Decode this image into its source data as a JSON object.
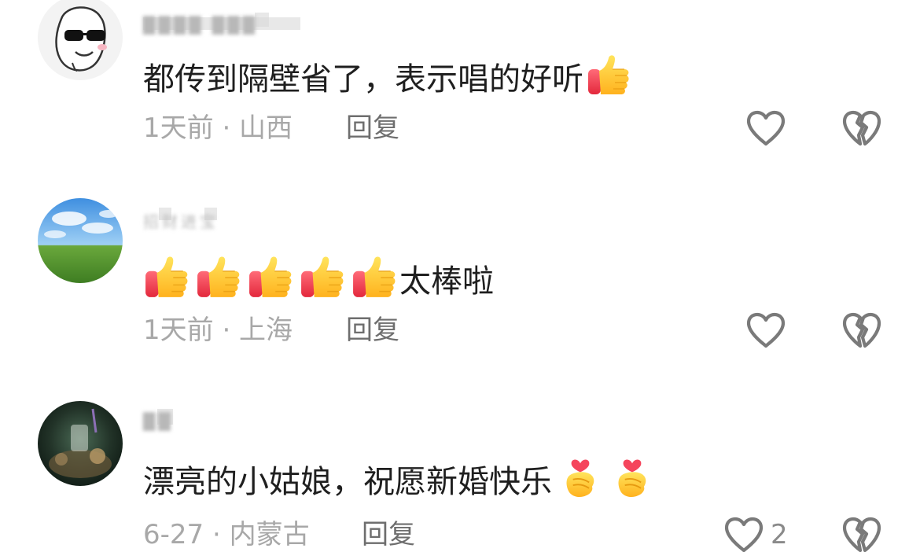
{
  "comments": [
    {
      "username": "████ ███",
      "text": "都传到隔壁省了，表示唱的好听",
      "emojis": [
        "thumbs-up"
      ],
      "meta": "1天前 · 山西",
      "reply_label": "回复",
      "like_count": "",
      "avatar": "meme-face-sunglasses"
    },
    {
      "username": "招财进宝",
      "text": "太棒啦",
      "emojis_before": [
        "thumbs-up",
        "thumbs-up",
        "thumbs-up",
        "thumbs-up",
        "thumbs-up"
      ],
      "meta": "1天前 · 上海",
      "reply_label": "回复",
      "like_count": "",
      "avatar": "sky-grassland"
    },
    {
      "username": "██",
      "text": "漂亮的小姑娘，祝愿新婚快乐",
      "emojis": [
        "finger-heart",
        "finger-heart"
      ],
      "meta": "6-27 · 内蒙古",
      "reply_label": "回复",
      "like_count": "2",
      "avatar": "still-life-dark"
    }
  ],
  "colors": {
    "text_primary": "#1f1f1f",
    "text_meta": "#a8a8a8",
    "reply": "#6e6e6e",
    "icon": "#7a7a7a",
    "thumb_yellow": "#ffcc33",
    "thumb_red": "#f04a5a"
  }
}
